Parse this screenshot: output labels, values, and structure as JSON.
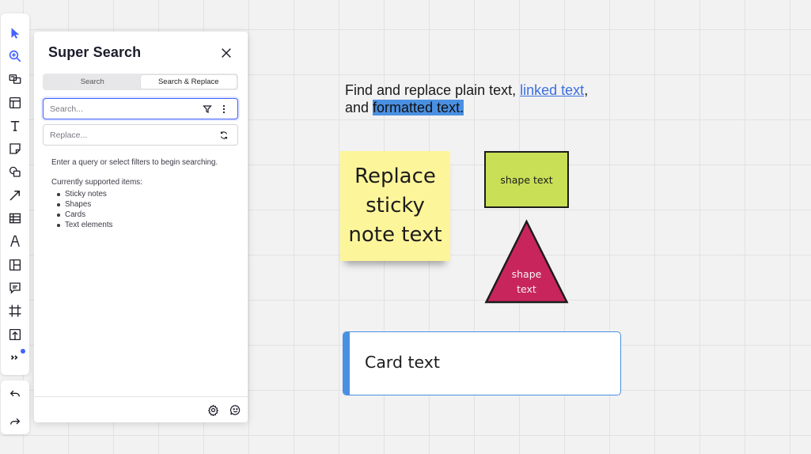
{
  "toolbar": {
    "tools": [
      {
        "name": "select-tool",
        "icon": "cursor-icon",
        "active": true
      },
      {
        "name": "super-search-tool",
        "icon": "magnifier-icon",
        "active": true
      },
      {
        "name": "templates-tool",
        "icon": "templates-icon"
      },
      {
        "name": "frames-layout-tool",
        "icon": "layout-icon"
      },
      {
        "name": "text-tool",
        "icon": "text-icon"
      },
      {
        "name": "sticky-note-tool",
        "icon": "sticky-note-icon"
      },
      {
        "name": "shapes-tool",
        "icon": "shapes-icon"
      },
      {
        "name": "connection-line-tool",
        "icon": "arrow-icon"
      },
      {
        "name": "table-tool",
        "icon": "table-icon"
      },
      {
        "name": "pen-tool",
        "icon": "pen-icon"
      },
      {
        "name": "kanban-tool",
        "icon": "kanban-icon"
      },
      {
        "name": "comment-tool",
        "icon": "comment-icon"
      },
      {
        "name": "frame-tool",
        "icon": "frame-icon"
      },
      {
        "name": "upload-tool",
        "icon": "upload-icon"
      },
      {
        "name": "more-apps-tool",
        "icon": "double-chevron-icon"
      }
    ],
    "accent": "#4262ff"
  },
  "panel": {
    "title": "Super Search",
    "tabs": [
      {
        "label": "Search",
        "selected": false
      },
      {
        "label": "Search & Replace",
        "selected": true
      }
    ],
    "search": {
      "value": "",
      "placeholder": "Search..."
    },
    "replace": {
      "value": "",
      "placeholder": "Replace..."
    },
    "hint": "Enter a query or select filters to begin searching.",
    "supported_title": "Currently supported items:",
    "supported_items": [
      "Sticky notes",
      "Shapes",
      "Cards",
      "Text elements"
    ]
  },
  "canvas": {
    "text": {
      "part1": "Find and replace plain text, ",
      "link": "linked text",
      "part2": ",",
      "part3": "and ",
      "highlight": "formatted text."
    },
    "sticky": {
      "text": "Replace sticky note text",
      "color": "#fdf59a"
    },
    "rect_shape": {
      "text": "shape text",
      "color": "#c9df56"
    },
    "triangle_shape": {
      "line1": "shape",
      "line2": "text",
      "color": "#c8255c"
    },
    "card": {
      "title": "Card text",
      "accent": "#4a90e2"
    }
  }
}
